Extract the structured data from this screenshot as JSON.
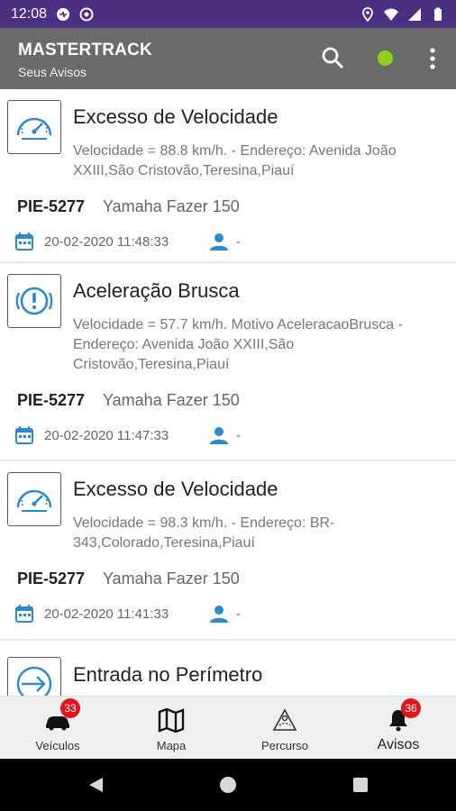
{
  "status_bar": {
    "time": "12:08"
  },
  "app_bar": {
    "title": "MASTERTRACK",
    "subtitle": "Seus Avisos",
    "status_color": "#8fd21a"
  },
  "alerts": [
    {
      "icon": "speedometer-icon",
      "title": "Excesso de Velocidade",
      "description": "Velocidade = 88.8 km/h. - Endereço: Avenida João XXIII,São Cristovão,Teresina,Piauí",
      "plate": "PIE-5277",
      "vehicle": "Yamaha Fazer 150",
      "datetime": "20-02-2020 11:48:33",
      "driver": "-"
    },
    {
      "icon": "alert-circle-icon",
      "title": "Aceleração Brusca",
      "description": "Velocidade = 57.7 km/h. Motivo AceleracaoBrusca - Endereço: Avenida João XXIII,São Cristovão,Teresina,Piauí",
      "plate": "PIE-5277",
      "vehicle": "Yamaha Fazer 150",
      "datetime": "20-02-2020 11:47:33",
      "driver": "-"
    },
    {
      "icon": "speedometer-icon",
      "title": "Excesso de Velocidade",
      "description": "Velocidade = 98.3 km/h. - Endereço: BR-343,Colorado,Teresina,Piauí",
      "plate": "PIE-5277",
      "vehicle": "Yamaha Fazer 150",
      "datetime": "20-02-2020 11:41:33",
      "driver": "-"
    },
    {
      "icon": "enter-perimeter-icon",
      "title": "Entrada no Perímetro"
    }
  ],
  "bottom_nav": [
    {
      "label": "Veículos",
      "badge": "33",
      "icon": "car-icon"
    },
    {
      "label": "Mapa",
      "icon": "map-icon"
    },
    {
      "label": "Percurso",
      "icon": "route-icon"
    },
    {
      "label": "Avisos",
      "badge": "36",
      "icon": "bell-icon",
      "active": true
    }
  ]
}
